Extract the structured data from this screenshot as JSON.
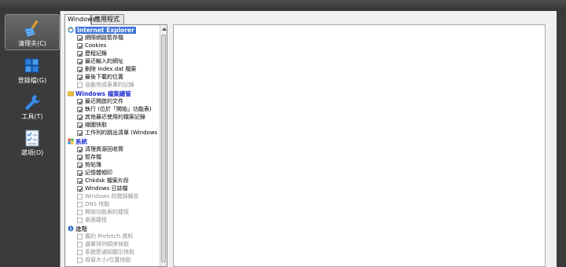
{
  "sidebar": {
    "items": [
      {
        "label": "清理夫(C)",
        "icon": "broom-icon",
        "active": true
      },
      {
        "label": "登錄檔(G)",
        "icon": "registry-cubes-icon",
        "active": false
      },
      {
        "label": "工具(T)",
        "icon": "wrench-icon",
        "active": false
      },
      {
        "label": "選項(O)",
        "icon": "checklist-icon",
        "active": false
      }
    ]
  },
  "tabs": [
    {
      "label": "Windows",
      "active": true
    },
    {
      "label": "應用程式",
      "active": false
    }
  ],
  "groups": [
    {
      "title": "Internet Explorer",
      "icon": "internet-explorer-icon",
      "items": [
        {
          "label": "網際網路暫存檔",
          "checked": true
        },
        {
          "label": "Cookies",
          "checked": true
        },
        {
          "label": "歷程記錄",
          "checked": true
        },
        {
          "label": "最近輸入的網址",
          "checked": true
        },
        {
          "label": "刪除 Index.dat 檔案",
          "checked": true
        },
        {
          "label": "最後下載的位置",
          "checked": true
        },
        {
          "label": "自動完成表單的記錄",
          "checked": false
        }
      ]
    },
    {
      "title": "Windows 檔案總管",
      "icon": "windows-explorer-icon",
      "items": [
        {
          "label": "最近開啟的文件",
          "checked": true
        },
        {
          "label": "執行 (位於「開始」功能表)",
          "checked": true
        },
        {
          "label": "其他最近使用的檔案記錄",
          "checked": true
        },
        {
          "label": "縮圖快取",
          "checked": true
        },
        {
          "label": "工作列的跳出清單 (Windows",
          "checked": true
        }
      ]
    },
    {
      "title": "系統",
      "icon": "windows-flag-icon",
      "items": [
        {
          "label": "清理資源回收筒",
          "checked": true
        },
        {
          "label": "暫存檔",
          "checked": true
        },
        {
          "label": "剪貼簿",
          "checked": true
        },
        {
          "label": "記憶體傾印",
          "checked": true
        },
        {
          "label": "Chkdsk 檔案片段",
          "checked": true
        },
        {
          "label": "Windows 日誌檔",
          "checked": true
        },
        {
          "label": "Windows 的錯誤報告",
          "checked": false
        },
        {
          "label": "DNS 快取",
          "checked": false
        },
        {
          "label": "開始功能表的捷徑",
          "checked": false
        },
        {
          "label": "桌面捷徑",
          "checked": false
        }
      ]
    },
    {
      "title": "進階",
      "icon": "advanced-info-icon",
      "items": [
        {
          "label": "舊的 Prefetch 資料",
          "checked": false
        },
        {
          "label": "選單排列順序快取",
          "checked": false
        },
        {
          "label": "系統匣通知圖示快取",
          "checked": false
        },
        {
          "label": "視窗大小/位置快取",
          "checked": false
        }
      ]
    }
  ]
}
